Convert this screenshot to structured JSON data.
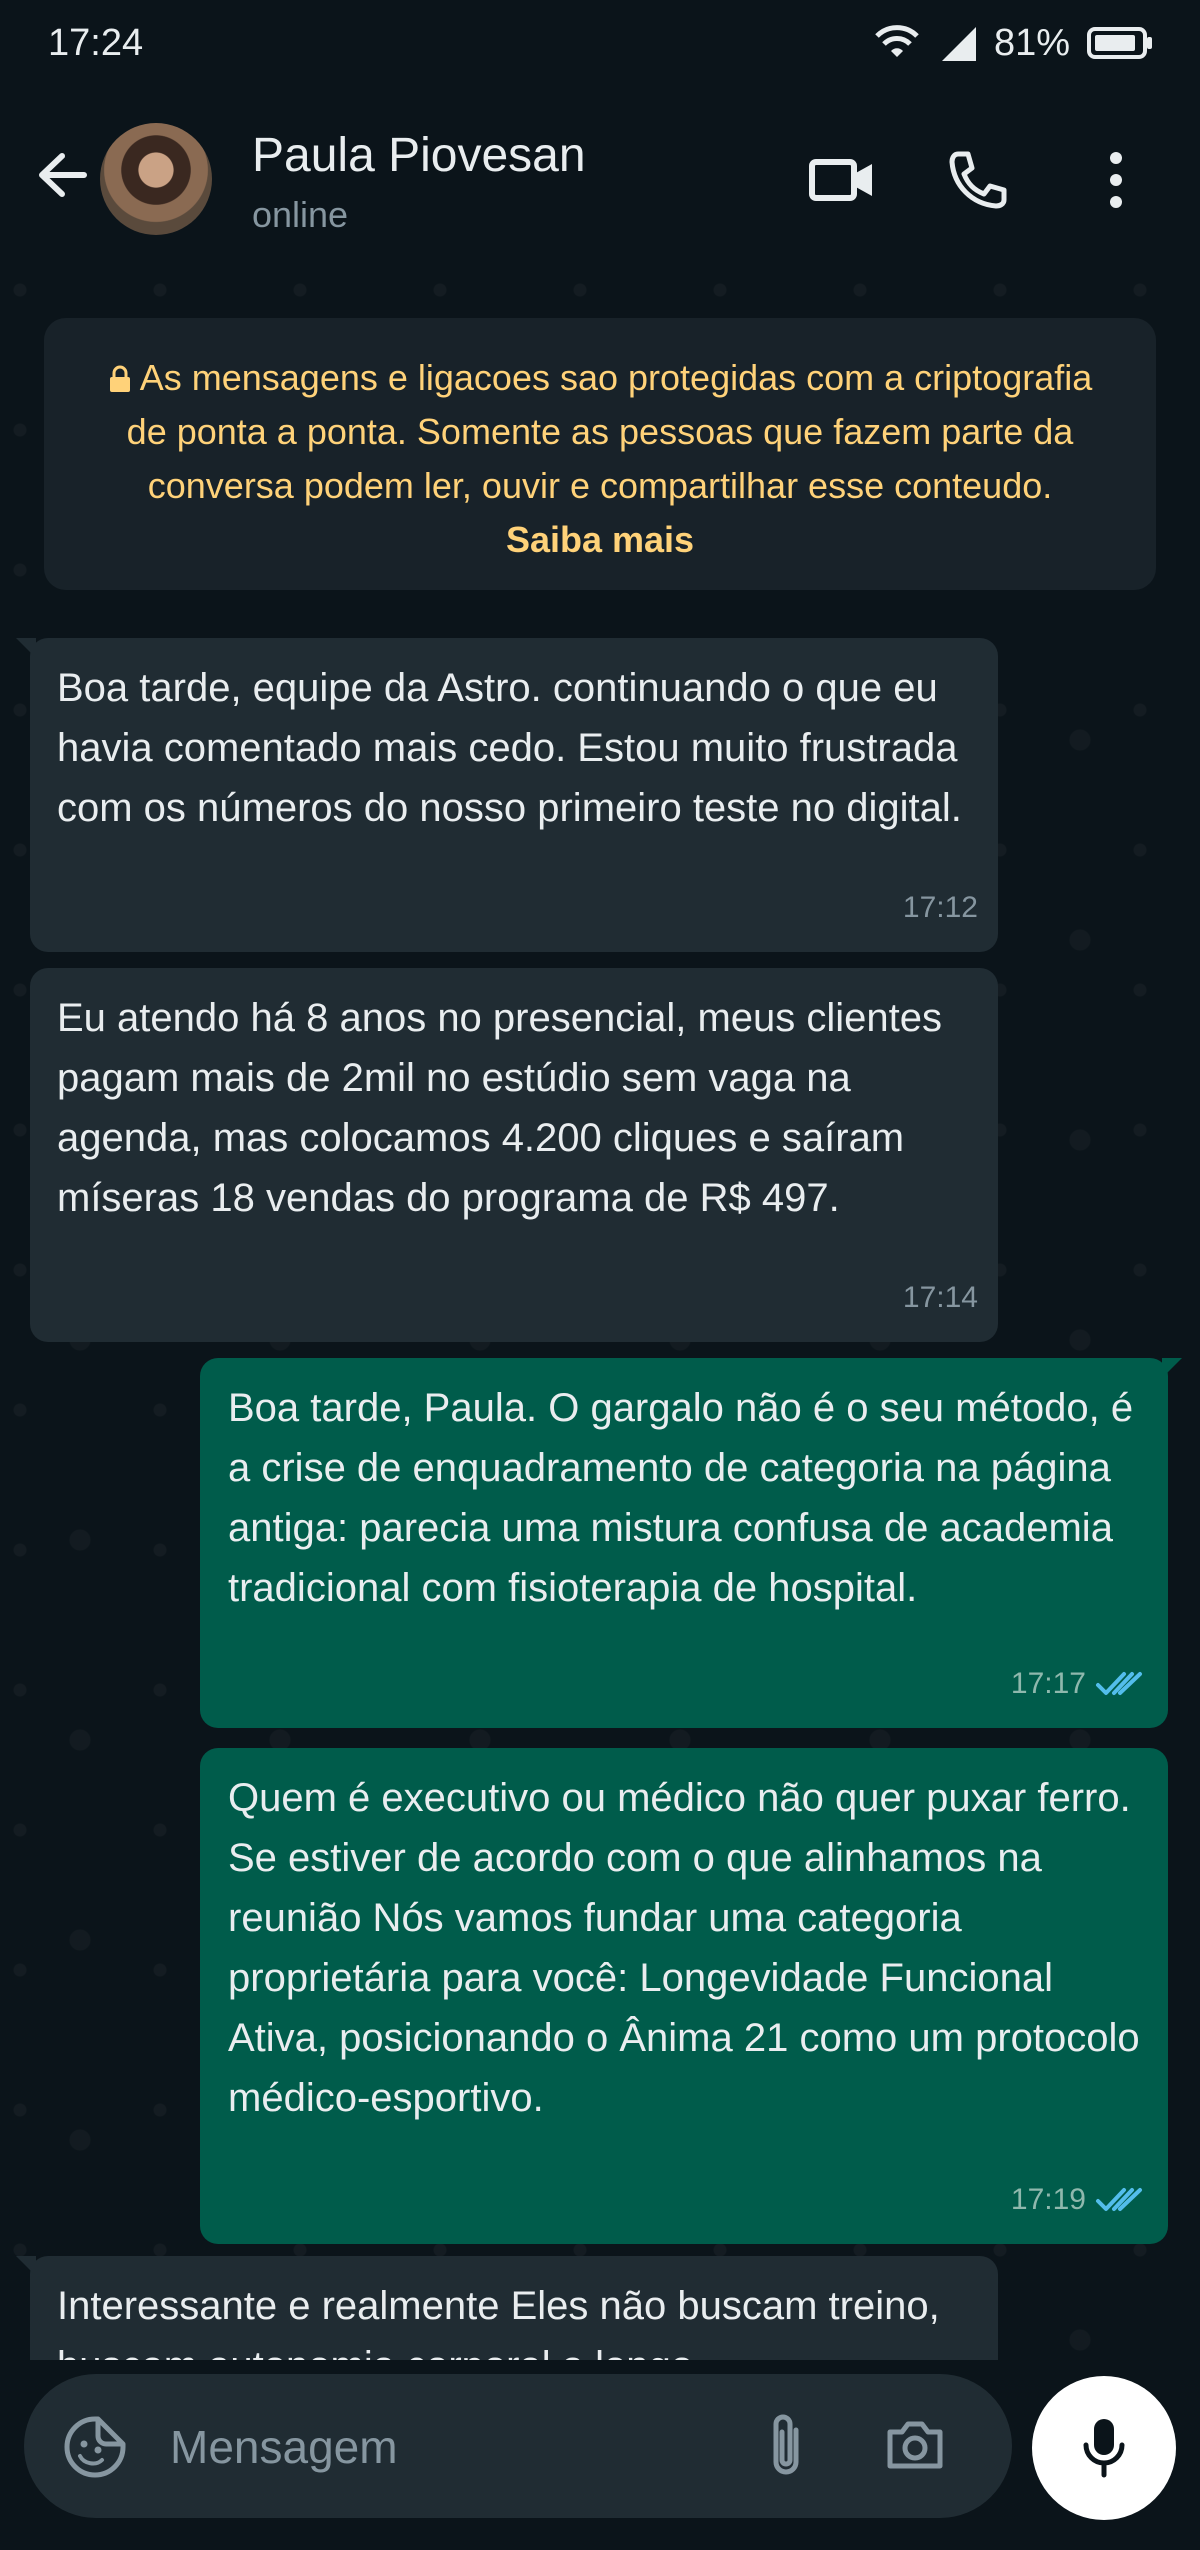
{
  "status_bar": {
    "time": "17:24",
    "battery": "81%"
  },
  "header": {
    "contact_name": "Paula Piovesan",
    "contact_status": "online"
  },
  "encryption_notice": {
    "text": "As mensagens e ligacoes sao protegidas com a criptografia de ponta a ponta. Somente as pessoas que fazem parte da conversa podem ler, ouvir e compartilhar esse conteudo. ",
    "link": "Saiba mais"
  },
  "messages": [
    {
      "direction": "in",
      "text": "Boa tarde, equipe da Astro. continuando o que eu havia comentado mais cedo. Estou muito frustrada com os números do nosso primeiro teste no digital.",
      "time": "17:12"
    },
    {
      "direction": "in",
      "text": "Eu atendo há 8 anos no presencial, meus clientes pagam mais de 2mil no estúdio sem vaga na agenda, mas colocamos 4.200 cliques e saíram míseras 18 vendas do programa de R$ 497.",
      "time": "17:14"
    },
    {
      "direction": "out",
      "text": "Boa tarde, Paula. O gargalo não é o seu método, é a crise de enquadramento de categoria na página antiga: parecia uma mistura confusa de academia tradicional com fisioterapia de hospital.",
      "time": "17:17",
      "status": "read"
    },
    {
      "direction": "out",
      "text": "Quem é executivo ou médico não quer puxar ferro. Se estiver de acordo com o que alinhamos na reunião Nós vamos fundar uma categoria proprietária para você: Longevidade Funcional Ativa, posicionando o Ânima 21 como um protocolo médico-esportivo.",
      "time": "17:19",
      "status": "read"
    },
    {
      "direction": "in",
      "text": "Interessante e realmente Eles não buscam treino, buscam autonomia corporal a longo",
      "time": ""
    }
  ],
  "composer": {
    "placeholder": "Mensagem"
  },
  "colors": {
    "incoming_bubble": "#202c33",
    "outgoing_bubble": "#005c4b",
    "read_ticks": "#53bdeb",
    "notice_text": "#ffd279"
  }
}
